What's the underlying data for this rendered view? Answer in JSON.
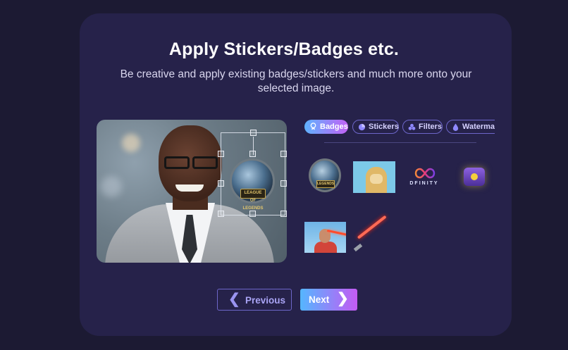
{
  "header": {
    "title": "Apply Stickers/Badges etc.",
    "subtitle": "Be creative and apply existing badges/stickers and much more onto your selected image."
  },
  "editor": {
    "placed_sticker_label": "LEAGUE OF LEGENDS"
  },
  "tabs": [
    {
      "label": "Badges",
      "icon": "badge-icon",
      "active": true
    },
    {
      "label": "Stickers",
      "icon": "sticker-icon",
      "active": false
    },
    {
      "label": "Filters",
      "icon": "filters-icon",
      "active": false
    },
    {
      "label": "Watermark",
      "icon": "watermark-icon",
      "active": false
    }
  ],
  "stickers": [
    {
      "name": "league-of-legends-badge",
      "label": "LEGENDS"
    },
    {
      "name": "ape-nft-sticker"
    },
    {
      "name": "dfinity-logo",
      "label": "DFINITY"
    },
    {
      "name": "treasure-chest-sticker"
    },
    {
      "name": "laser-eyes-person-sticker"
    },
    {
      "name": "lightsaber-sticker"
    }
  ],
  "nav": {
    "previous_label": "Previous",
    "next_label": "Next"
  },
  "colors": {
    "background": "#1c1a33",
    "card": "#26224a",
    "accent_start": "#55b6ff",
    "accent_end": "#c45bf3",
    "outline": "#6d66c9"
  }
}
